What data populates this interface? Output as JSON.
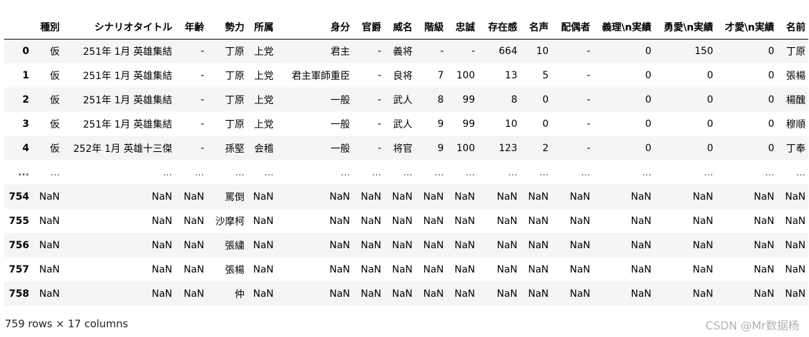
{
  "table": {
    "columns": [
      "",
      "種別",
      "シナリオタイトル",
      "年齢",
      "勢力",
      "所属",
      "身分",
      "官爵",
      "威名",
      "階級",
      "忠誠",
      "存在感",
      "名声",
      "配偶者",
      "義理\\n実績",
      "勇愛\\n実績",
      "才愛\\n実績",
      "名前"
    ],
    "rows": [
      [
        "0",
        "仮",
        "251年 1月 英雄集結",
        "-",
        "丁原",
        "上党",
        "君主",
        "-",
        "義将",
        "-",
        "-",
        "664",
        "10",
        "-",
        "0",
        "150",
        "0",
        "丁原"
      ],
      [
        "1",
        "仮",
        "251年 1月 英雄集結",
        "-",
        "丁原",
        "上党",
        "君主軍師重臣",
        "-",
        "良将",
        "7",
        "100",
        "13",
        "5",
        "-",
        "0",
        "0",
        "0",
        "張楊"
      ],
      [
        "2",
        "仮",
        "251年 1月 英雄集結",
        "-",
        "丁原",
        "上党",
        "一般",
        "-",
        "武人",
        "8",
        "99",
        "8",
        "0",
        "-",
        "0",
        "0",
        "0",
        "楊醜"
      ],
      [
        "3",
        "仮",
        "251年 1月 英雄集結",
        "-",
        "丁原",
        "上党",
        "一般",
        "-",
        "武人",
        "9",
        "99",
        "10",
        "0",
        "-",
        "0",
        "0",
        "0",
        "穆順"
      ],
      [
        "4",
        "仮",
        "252年 1月 英雄十三傑",
        "-",
        "孫堅",
        "会稽",
        "一般",
        "-",
        "将官",
        "9",
        "100",
        "123",
        "2",
        "-",
        "0",
        "0",
        "0",
        "丁奉"
      ],
      [
        "...",
        "...",
        "...",
        "...",
        "...",
        "...",
        "...",
        "...",
        "...",
        "...",
        "...",
        "...",
        "...",
        "...",
        "...",
        "...",
        "...",
        "..."
      ],
      [
        "754",
        "NaN",
        "NaN",
        "NaN",
        "罵倒",
        "NaN",
        "NaN",
        "NaN",
        "NaN",
        "NaN",
        "NaN",
        "NaN",
        "NaN",
        "NaN",
        "NaN",
        "NaN",
        "NaN",
        "NaN"
      ],
      [
        "755",
        "NaN",
        "NaN",
        "NaN",
        "沙摩柯",
        "NaN",
        "NaN",
        "NaN",
        "NaN",
        "NaN",
        "NaN",
        "NaN",
        "NaN",
        "NaN",
        "NaN",
        "NaN",
        "NaN",
        "NaN"
      ],
      [
        "756",
        "NaN",
        "NaN",
        "NaN",
        "張繍",
        "NaN",
        "NaN",
        "NaN",
        "NaN",
        "NaN",
        "NaN",
        "NaN",
        "NaN",
        "NaN",
        "NaN",
        "NaN",
        "NaN",
        "NaN"
      ],
      [
        "757",
        "NaN",
        "NaN",
        "NaN",
        "張楊",
        "NaN",
        "NaN",
        "NaN",
        "NaN",
        "NaN",
        "NaN",
        "NaN",
        "NaN",
        "NaN",
        "NaN",
        "NaN",
        "NaN",
        "NaN"
      ],
      [
        "758",
        "NaN",
        "NaN",
        "NaN",
        "仲",
        "NaN",
        "NaN",
        "NaN",
        "NaN",
        "NaN",
        "NaN",
        "NaN",
        "NaN",
        "NaN",
        "NaN",
        "NaN",
        "NaN",
        "NaN"
      ]
    ]
  },
  "summary": "759 rows × 17 columns",
  "watermark": "CSDN @Mr数据杨",
  "colors": {
    "stripe": "#f5f5f5",
    "header_rule": "#000000",
    "watermark": "#b3b3b3"
  }
}
